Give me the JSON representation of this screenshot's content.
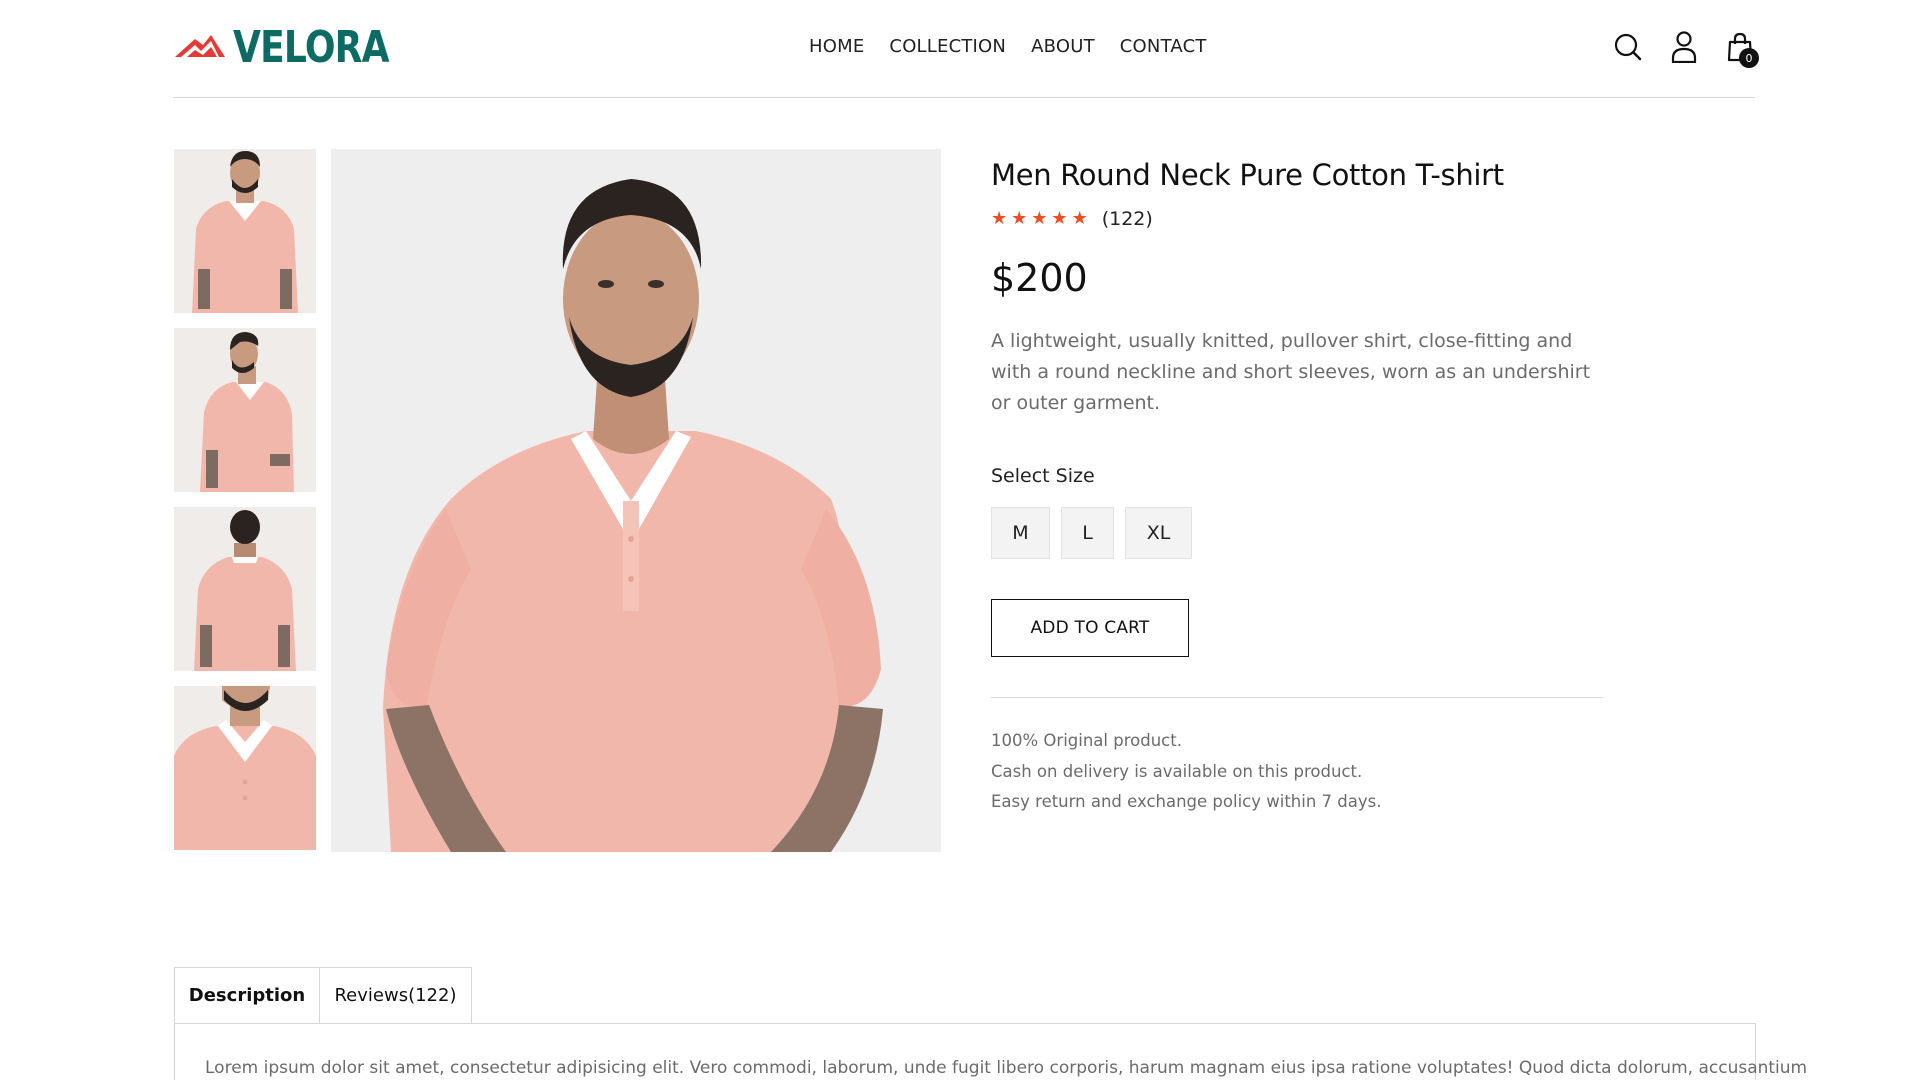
{
  "brand": {
    "name": "VELORA",
    "color": "#0e6b63",
    "accent": "#e53935"
  },
  "nav": {
    "items": [
      "HOME",
      "COLLECTION",
      "ABOUT",
      "CONTACT"
    ]
  },
  "header_icons": {
    "search": "search-icon",
    "profile": "user-icon",
    "cart": "shopping-bag-icon",
    "cart_count": "0"
  },
  "gallery": {
    "thumbnails": [
      "front view",
      "side view",
      "back view",
      "close-up view"
    ],
    "main_image": "model in pink polo t-shirt"
  },
  "product": {
    "title": "Men Round Neck Pure Cotton T-shirt",
    "rating": 5,
    "rating_count": "(122)",
    "price": "$200",
    "description": "A lightweight, usually knitted, pullover shirt, close-fitting and with a round neckline and short sleeves, worn as an undershirt or outer garment.",
    "size_label": "Select Size",
    "sizes": [
      "M",
      "L",
      "XL"
    ],
    "add_to_cart": "ADD TO CART",
    "features": [
      "100% Original product.",
      "Cash on delivery is available on this product.",
      "Easy return and exchange policy within 7 days."
    ],
    "star_color": "#ef4c24"
  },
  "tabs": {
    "items": [
      "Description",
      "Reviews(122)"
    ],
    "active": "Description",
    "description_text": "Lorem ipsum dolor sit amet, consectetur adipisicing elit. Vero commodi, laborum, unde fugit libero corporis, harum magnam eius ipsa ratione voluptates! Quod dicta dolorum, accusantium"
  }
}
